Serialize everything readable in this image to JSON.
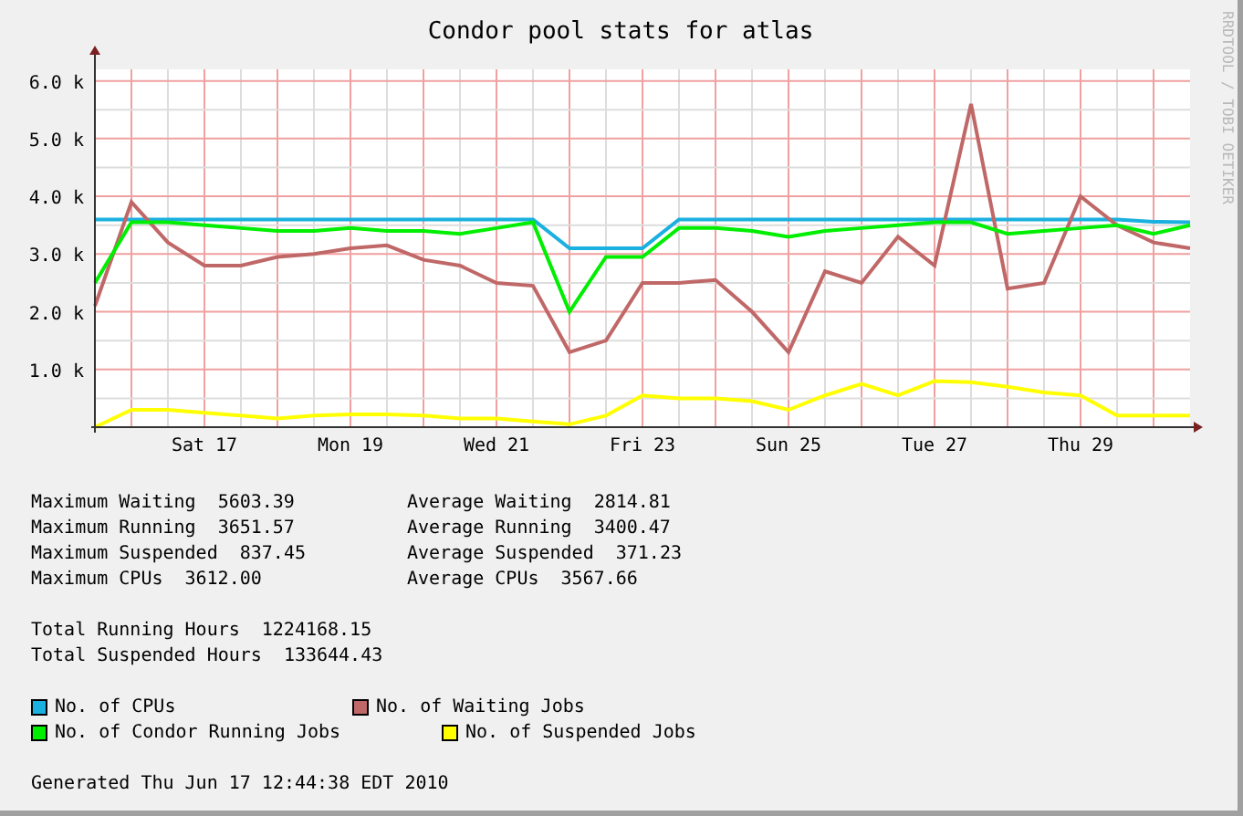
{
  "watermark_side": "RRDTOOL / TOBI OETIKER",
  "chart_data": {
    "type": "line",
    "title": "Condor pool stats for atlas",
    "categories": [
      null,
      null,
      null,
      "Sat 17",
      null,
      null,
      null,
      "Mon 19",
      null,
      null,
      null,
      "Wed 21",
      null,
      null,
      null,
      "Fri 23",
      null,
      null,
      null,
      "Sun 25",
      null,
      null,
      null,
      "Tue 27",
      null,
      null,
      null,
      "Thu 29",
      null,
      null,
      null
    ],
    "ylim": [
      0,
      6200
    ],
    "grid": true,
    "yticks": [
      {
        "value": 1000,
        "label": "1.0 k"
      },
      {
        "value": 2000,
        "label": "2.0 k"
      },
      {
        "value": 3000,
        "label": "3.0 k"
      },
      {
        "value": 4000,
        "label": "4.0 k"
      },
      {
        "value": 5000,
        "label": "5.0 k"
      },
      {
        "value": 6000,
        "label": "6.0 k"
      }
    ],
    "series": [
      {
        "name": "No. of CPUs",
        "color": "#1ab0e0",
        "values": [
          3600,
          3600,
          3600,
          3600,
          3600,
          3600,
          3600,
          3600,
          3600,
          3600,
          3600,
          3600,
          3600,
          3100,
          3100,
          3100,
          3600,
          3600,
          3600,
          3600,
          3600,
          3600,
          3600,
          3600,
          3600,
          3600,
          3600,
          3600,
          3600,
          3560,
          3550
        ]
      },
      {
        "name": "No. of Waiting Jobs",
        "color": "#c06868",
        "values": [
          2100,
          3900,
          3200,
          2800,
          2800,
          2950,
          3000,
          3100,
          3150,
          2900,
          2800,
          2500,
          2450,
          1300,
          1500,
          2500,
          2500,
          2550,
          2000,
          1300,
          2700,
          2500,
          3300,
          2800,
          5600,
          2400,
          2500,
          4000,
          3500,
          3200,
          3100
        ]
      },
      {
        "name": "No. of Condor Running Jobs",
        "color": "#00ee00",
        "values": [
          2500,
          3550,
          3550,
          3500,
          3450,
          3400,
          3400,
          3450,
          3400,
          3400,
          3350,
          3450,
          3550,
          2000,
          2950,
          2950,
          3450,
          3450,
          3400,
          3300,
          3400,
          3450,
          3500,
          3550,
          3550,
          3350,
          3400,
          3450,
          3500,
          3350,
          3500
        ]
      },
      {
        "name": "No. of Suspended Jobs",
        "color": "#ffff00",
        "values": [
          0,
          300,
          300,
          250,
          200,
          150,
          200,
          220,
          220,
          200,
          150,
          150,
          100,
          50,
          200,
          550,
          500,
          500,
          450,
          300,
          550,
          750,
          550,
          800,
          780,
          700,
          600,
          550,
          200,
          200,
          200
        ]
      }
    ]
  },
  "stats": [
    [
      {
        "label": "Maximum Waiting",
        "value": "5603.39"
      },
      {
        "label": "Average Waiting",
        "value": "2814.81"
      }
    ],
    [
      {
        "label": "Maximum Running",
        "value": "3651.57"
      },
      {
        "label": "Average Running",
        "value": "3400.47"
      }
    ],
    [
      {
        "label": "Maximum Suspended",
        "value": "837.45"
      },
      {
        "label": "Average Suspended",
        "value": "371.23"
      }
    ],
    [
      {
        "label": "Maximum CPUs",
        "value": "3612.00"
      },
      {
        "label": "Average CPUs",
        "value": "3567.66"
      }
    ]
  ],
  "totals": [
    {
      "label": "Total Running Hours",
      "value": "1224168.15"
    },
    {
      "label": "Total Suspended Hours",
      "value": "133644.43"
    }
  ],
  "footer": "Generated Thu Jun 17 12:44:38 EDT 2010"
}
